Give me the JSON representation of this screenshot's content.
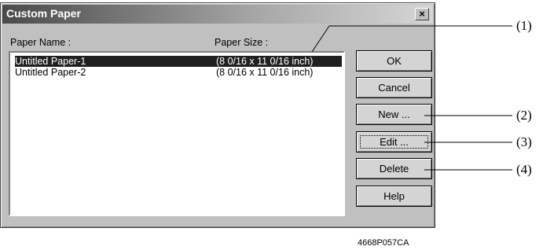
{
  "window": {
    "title": "Custom Paper",
    "close_glyph": "×"
  },
  "list": {
    "headers": {
      "name": "Paper Name :",
      "size": "Paper Size :"
    },
    "rows": [
      {
        "name": "Untitled Paper-1",
        "size": "(8 0/16 x 11 0/16 inch)",
        "selected": true
      },
      {
        "name": "Untitled Paper-2",
        "size": "(8 0/16 x 11 0/16 inch)",
        "selected": false
      }
    ]
  },
  "buttons": {
    "ok": "OK",
    "cancel": "Cancel",
    "new": "New ...",
    "edit": "Edit ...",
    "delete": "Delete",
    "help": "Help"
  },
  "callouts": [
    "(1)",
    "(2)",
    "(3)",
    "(4)"
  ],
  "caption": "4668P057CA",
  "colors": {
    "selection": "#202020",
    "dialog_face": "#c0c0c0"
  }
}
